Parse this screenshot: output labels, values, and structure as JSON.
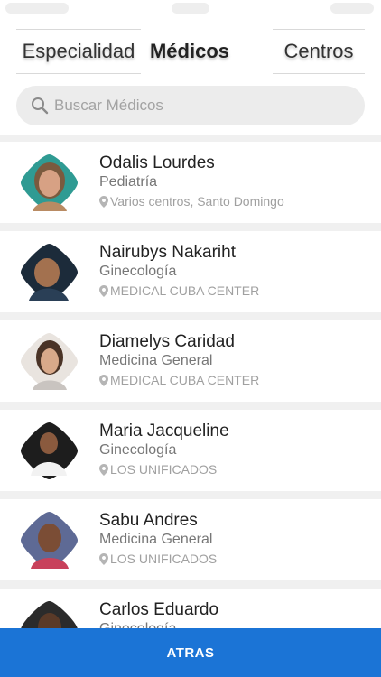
{
  "tabs": [
    {
      "label": "Especialidad",
      "active": false
    },
    {
      "label": "Médicos",
      "active": true
    },
    {
      "label": "Centros",
      "active": false
    }
  ],
  "search": {
    "placeholder": "Buscar Médicos",
    "icon": "search-icon"
  },
  "doctors": [
    {
      "name": "Odalis Lourdes",
      "specialty": "Pediatría",
      "location": "Varios centros, Santo Domingo"
    },
    {
      "name": "Nairubys Nakariht",
      "specialty": "Ginecología",
      "location": "MEDICAL CUBA CENTER"
    },
    {
      "name": "Diamelys Caridad",
      "specialty": "Medicina General",
      "location": "MEDICAL CUBA CENTER"
    },
    {
      "name": "Maria Jacqueline",
      "specialty": "Ginecología",
      "location": "LOS UNIFICADOS"
    },
    {
      "name": "Sabu Andres",
      "specialty": "Medicina General",
      "location": "LOS UNIFICADOS"
    },
    {
      "name": "Carlos Eduardo",
      "specialty": "Ginecología",
      "location": ""
    }
  ],
  "footer": {
    "back_label": "ATRAS"
  },
  "colors": {
    "accent": "#1b74d6",
    "teal": "#2f9b93"
  }
}
